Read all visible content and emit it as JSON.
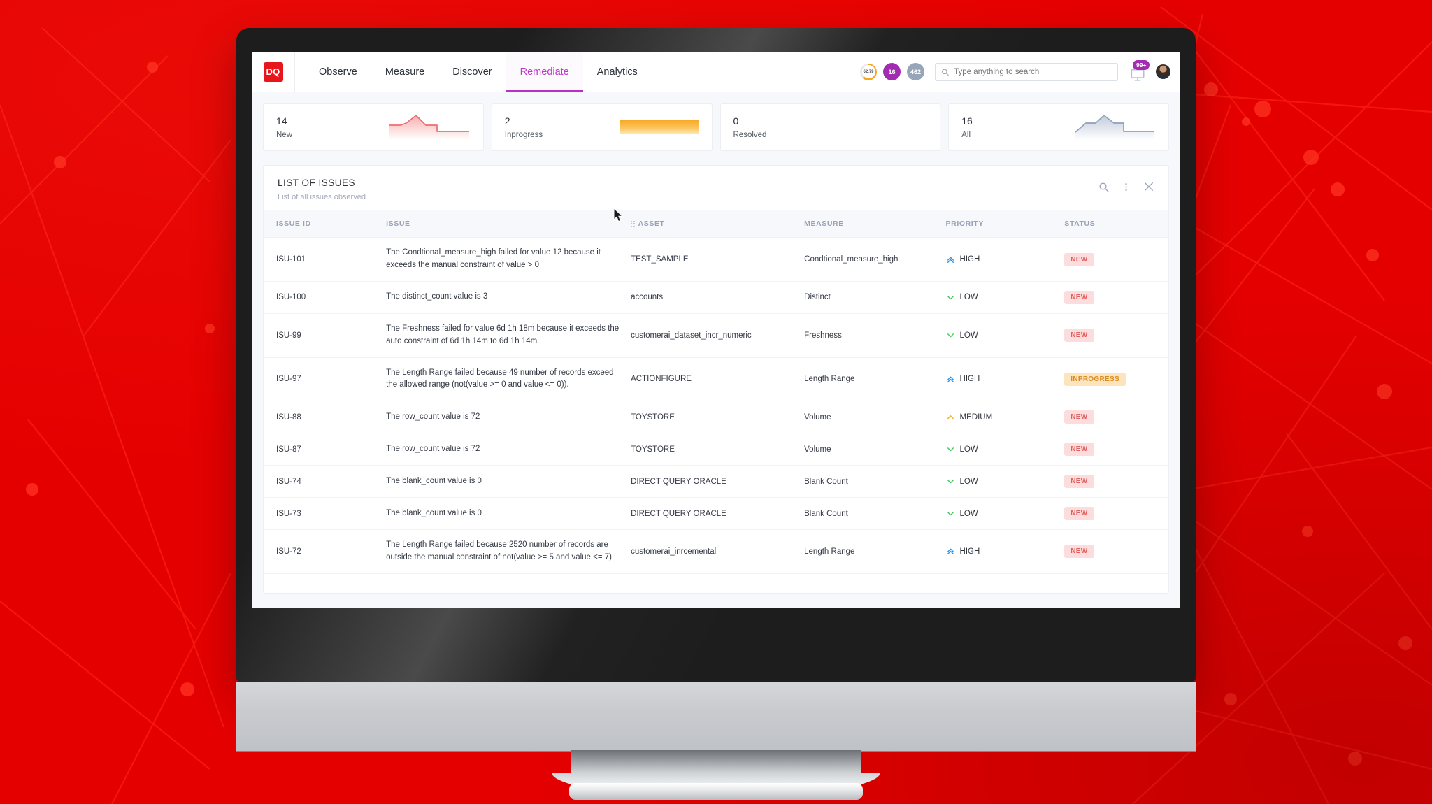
{
  "brand": {
    "logo_text": "DQ",
    "logo_color": "#e8161a",
    "accent_color": "#b830c6",
    "backdrop_color": "#e50000"
  },
  "nav": {
    "items": [
      {
        "label": "Observe",
        "active": false
      },
      {
        "label": "Measure",
        "active": false
      },
      {
        "label": "Discover",
        "active": false
      },
      {
        "label": "Remediate",
        "active": true
      },
      {
        "label": "Analytics",
        "active": false
      }
    ]
  },
  "header_right": {
    "score_gauge": {
      "value": "62.79",
      "arc_color": "#f6a623",
      "track_color": "#e9eaef"
    },
    "badge_purple": {
      "value": "16",
      "color": "#a32ab3"
    },
    "badge_gray": {
      "value": "462",
      "color": "#97a5b8"
    },
    "search": {
      "placeholder": "Type anything to search",
      "value": ""
    },
    "notification": {
      "count": "99+",
      "color": "#a32ab3",
      "icon": "monitor-icon"
    },
    "avatar": "user-avatar"
  },
  "kpi_cards": [
    {
      "value": "14",
      "label": "New",
      "viz": "sparkline",
      "color": "#ef6d6d"
    },
    {
      "value": "2",
      "label": "Inprogress",
      "viz": "bar",
      "color": "#f9a825"
    },
    {
      "value": "0",
      "label": "Resolved",
      "viz": "none",
      "color": "#8a97ad"
    },
    {
      "value": "16",
      "label": "All",
      "viz": "sparkline",
      "color": "#8fa1bd"
    }
  ],
  "panel": {
    "title": "LIST OF ISSUES",
    "subtitle": "List of all issues observed",
    "actions": [
      {
        "name": "search-icon",
        "label": "Search"
      },
      {
        "name": "more-options-icon",
        "label": "More options"
      },
      {
        "name": "close-icon",
        "label": "Close"
      }
    ]
  },
  "table": {
    "columns": [
      "ISSUE ID",
      "ISSUE",
      "ASSET",
      "MEASURE",
      "PRIORITY",
      "STATUS"
    ],
    "rows": [
      {
        "id": "ISU-101",
        "issue": "The Condtional_measure_high failed for value 12 because it exceeds the manual constraint of value > 0",
        "asset": "TEST_SAMPLE",
        "measure": "Condtional_measure_high",
        "priority": "HIGH",
        "priority_icon": "chevron-double-up-icon",
        "priority_color": "#2196f3",
        "status": "NEW",
        "status_class": "new"
      },
      {
        "id": "ISU-100",
        "issue": "The distinct_count value is 3",
        "asset": "accounts",
        "measure": "Distinct",
        "priority": "LOW",
        "priority_icon": "chevron-down-icon",
        "priority_color": "#49c55f",
        "status": "NEW",
        "status_class": "new"
      },
      {
        "id": "ISU-99",
        "issue": "The Freshness failed for value 6d 1h 18m because it exceeds the auto constraint of 6d 1h 14m to 6d 1h 14m",
        "asset": "customerai_dataset_incr_numeric",
        "measure": "Freshness",
        "priority": "LOW",
        "priority_icon": "chevron-down-icon",
        "priority_color": "#49c55f",
        "status": "NEW",
        "status_class": "new"
      },
      {
        "id": "ISU-97",
        "issue": "The Length Range failed because 49 number of records exceed the allowed range (not(value >= 0 and value <= 0)).",
        "asset": "ACTIONFIGURE",
        "measure": "Length Range",
        "priority": "HIGH",
        "priority_icon": "chevron-double-up-icon",
        "priority_color": "#2196f3",
        "status": "INPROGRESS",
        "status_class": "prog"
      },
      {
        "id": "ISU-88",
        "issue": "The row_count value is 72",
        "asset": "TOYSTORE",
        "measure": "Volume",
        "priority": "MEDIUM",
        "priority_icon": "chevron-up-icon",
        "priority_color": "#f2b01e",
        "status": "NEW",
        "status_class": "new"
      },
      {
        "id": "ISU-87",
        "issue": "The row_count value is 72",
        "asset": "TOYSTORE",
        "measure": "Volume",
        "priority": "LOW",
        "priority_icon": "chevron-down-icon",
        "priority_color": "#49c55f",
        "status": "NEW",
        "status_class": "new"
      },
      {
        "id": "ISU-74",
        "issue": "The blank_count value is 0",
        "asset": "DIRECT QUERY ORACLE",
        "measure": "Blank Count",
        "priority": "LOW",
        "priority_icon": "chevron-down-icon",
        "priority_color": "#49c55f",
        "status": "NEW",
        "status_class": "new"
      },
      {
        "id": "ISU-73",
        "issue": "The blank_count value is 0",
        "asset": "DIRECT QUERY ORACLE",
        "measure": "Blank Count",
        "priority": "LOW",
        "priority_icon": "chevron-down-icon",
        "priority_color": "#49c55f",
        "status": "NEW",
        "status_class": "new"
      },
      {
        "id": "ISU-72",
        "issue": "The Length Range failed because 2520 number of records are outside the manual constraint of not(value >= 5 and value <= 7)",
        "asset": "customerai_inrcemental",
        "measure": "Length Range",
        "priority": "HIGH",
        "priority_icon": "chevron-double-up-icon",
        "priority_color": "#2196f3",
        "status": "NEW",
        "status_class": "new"
      }
    ]
  }
}
